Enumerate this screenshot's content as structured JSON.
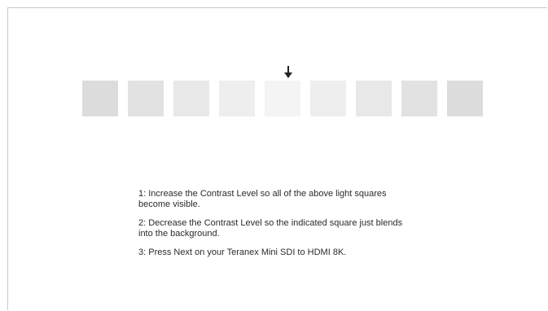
{
  "pointer_icon": "down-arrow-icon",
  "indicated_square": 4,
  "swatches": [
    "#dcdcdc",
    "#e2e2e2",
    "#e8e8e8",
    "#eeeeee",
    "#f4f4f4",
    "#eeeeee",
    "#e8e8e8",
    "#e2e2e2",
    "#dcdcdc"
  ],
  "instructions": {
    "step1": "1: Increase the Contrast Level so all of the above light squares become visible.",
    "step2": "2: Decrease the Contrast Level so the indicated square just blends into the background.",
    "step3": "3: Press Next on your Teranex Mini SDI to HDMI 8K."
  }
}
